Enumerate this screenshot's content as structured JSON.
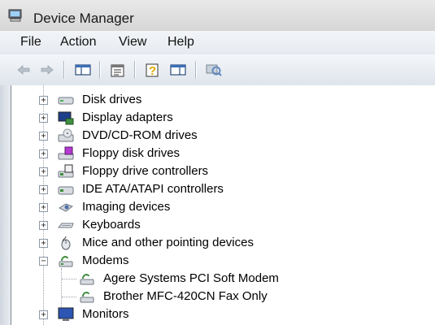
{
  "window": {
    "title": "Device Manager"
  },
  "menu": [
    "File",
    "Action",
    "View",
    "Help"
  ],
  "toolbar": [
    {
      "icon": "back-arrow-icon"
    },
    {
      "icon": "forward-arrow-icon"
    },
    {
      "icon": "show-hide-console-tree-icon"
    },
    {
      "icon": "properties-icon"
    },
    {
      "icon": "help-icon"
    },
    {
      "icon": "show-action-pane-icon"
    },
    {
      "icon": "scan-hardware-changes-icon"
    }
  ],
  "tree": [
    {
      "label": "Disk drives",
      "expander": "+",
      "icon": "disk-drive-icon"
    },
    {
      "label": "Display adapters",
      "expander": "+",
      "icon": "display-adapter-icon"
    },
    {
      "label": "DVD/CD-ROM drives",
      "expander": "+",
      "icon": "dvd-drive-icon"
    },
    {
      "label": "Floppy disk drives",
      "expander": "+",
      "icon": "floppy-drive-icon"
    },
    {
      "label": "Floppy drive controllers",
      "expander": "+",
      "icon": "floppy-controller-icon"
    },
    {
      "label": "IDE ATA/ATAPI controllers",
      "expander": "+",
      "icon": "ide-controller-icon"
    },
    {
      "label": "Imaging devices",
      "expander": "+",
      "icon": "imaging-device-icon"
    },
    {
      "label": "Keyboards",
      "expander": "+",
      "icon": "keyboard-icon"
    },
    {
      "label": "Mice and other pointing devices",
      "expander": "+",
      "icon": "mouse-icon"
    },
    {
      "label": "Modems",
      "expander": "−",
      "icon": "modem-icon",
      "children": [
        {
          "label": "Agere Systems PCI Soft Modem",
          "icon": "modem-device-icon"
        },
        {
          "label": "Brother MFC-420CN Fax Only",
          "icon": "modem-device-icon"
        }
      ]
    },
    {
      "label": "Monitors",
      "expander": "+",
      "icon": "monitor-icon"
    }
  ]
}
